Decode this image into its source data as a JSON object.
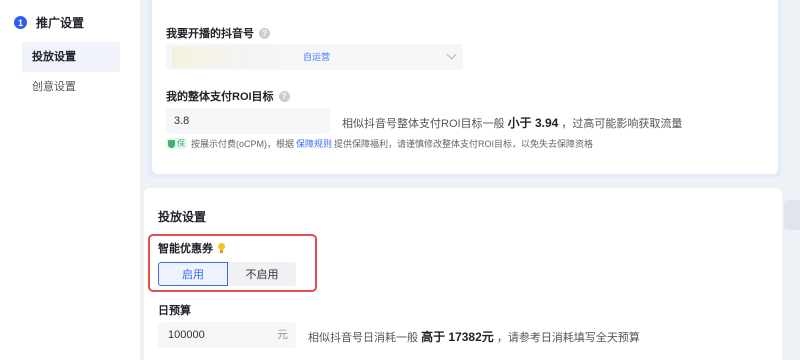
{
  "sidebar": {
    "step_number": "1",
    "step_title": "推广设置",
    "items": [
      {
        "label": "投放设置",
        "active": true
      },
      {
        "label": "创意设置",
        "active": false
      }
    ]
  },
  "account": {
    "label": "我要开播的抖音号",
    "tag": "自运营"
  },
  "roi": {
    "label": "我的整体支付ROI目标",
    "value": "3.8",
    "hint_prefix": "相似抖音号整体支付ROI目标一般",
    "hint_strong": "小于 3.94",
    "hint_suffix": "，过高可能影响获取流量",
    "shield_badge": "保",
    "shield_text_1": "按展示付费(oCPM)，根据",
    "shield_link": "保障规则",
    "shield_text_2": "提供保障福利，请谨慎修改整体支付ROI目标，以免失去保障资格"
  },
  "delivery": {
    "section_title": "投放设置",
    "coupon_label": "智能优惠券",
    "toggle_on": "启用",
    "toggle_off": "不启用",
    "selected": "启用"
  },
  "budget": {
    "label": "日预算",
    "value": "100000",
    "unit": "元",
    "hint_prefix": "相似抖音号日消耗一般",
    "hint_strong": "高于 17382元",
    "hint_suffix": "，请参考日消耗填写全天预算"
  },
  "colors": {
    "primary": "#3a6cf3",
    "highlight_border": "#e0504a",
    "shield_green": "#3cb371"
  }
}
